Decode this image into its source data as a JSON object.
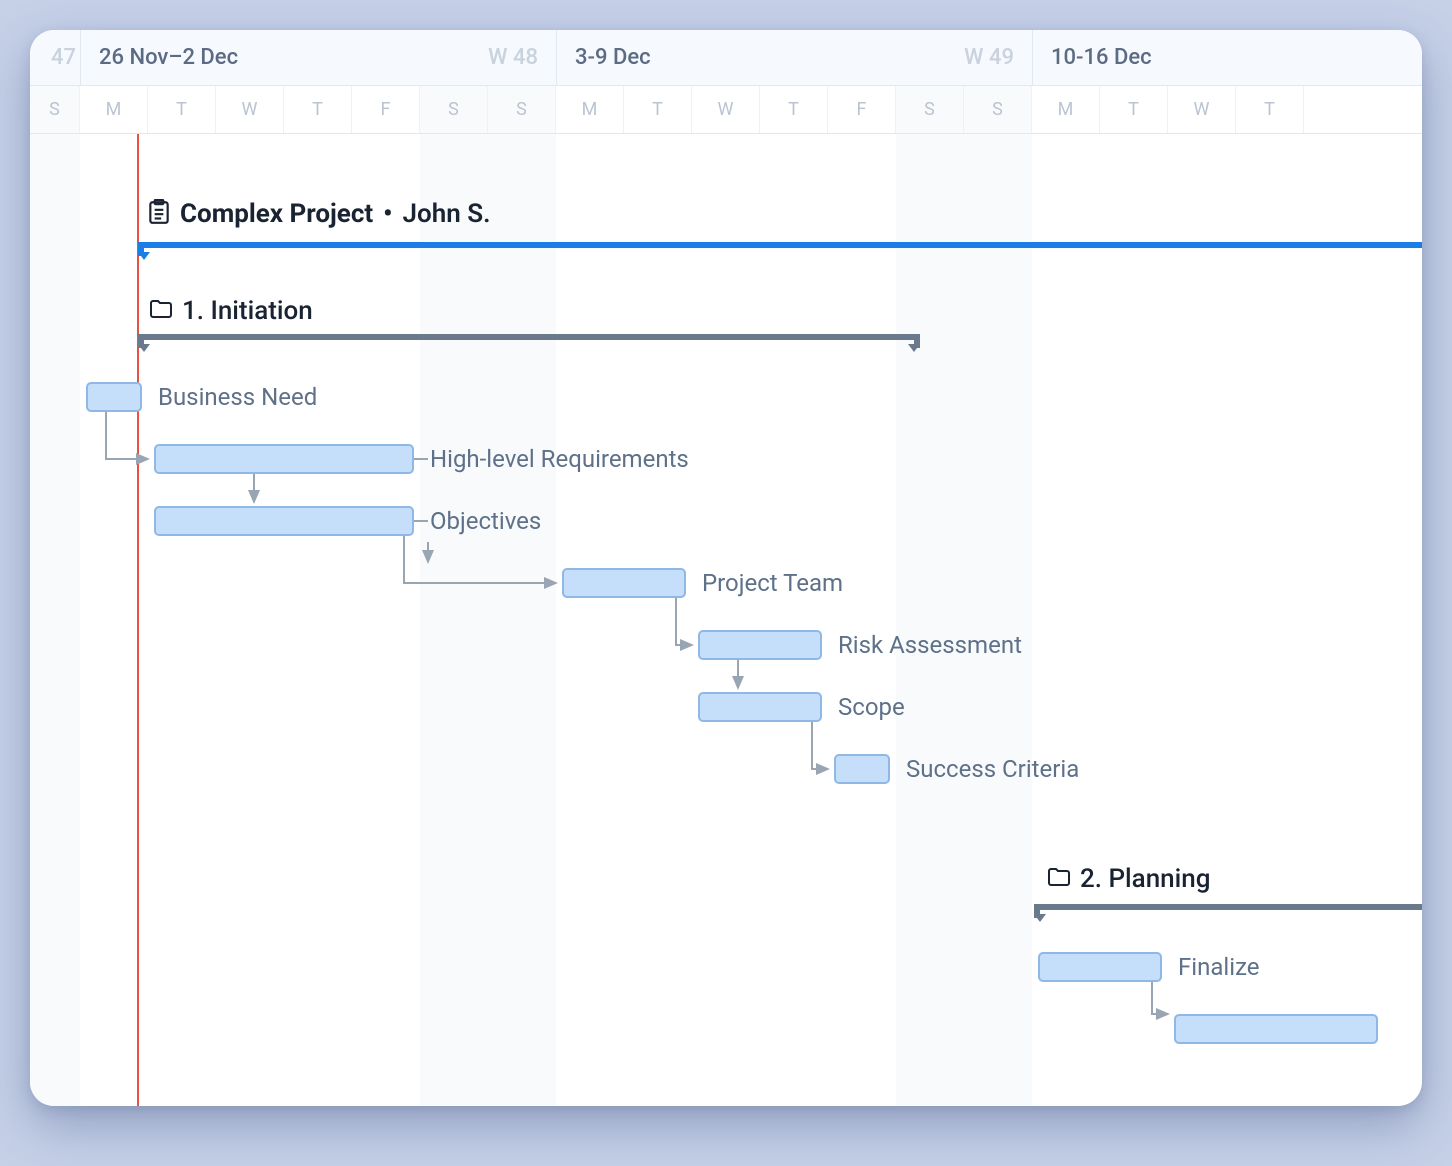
{
  "header": {
    "weeks": [
      {
        "pre": "47"
      },
      {
        "label": "26 Nov–2 Dec",
        "num": "W 48",
        "startCol": 1
      },
      {
        "label": "3-9 Dec",
        "num": "W 49",
        "startCol": 8
      },
      {
        "label": "10-16 Dec",
        "num": "",
        "startCol": 15
      }
    ],
    "days": [
      "S",
      "M",
      "T",
      "W",
      "T",
      "F",
      "S",
      "S",
      "M",
      "T",
      "W",
      "T",
      "F",
      "S",
      "S",
      "M",
      "T",
      "W",
      "T"
    ]
  },
  "project": {
    "title": "Complex Project",
    "owner": "John S."
  },
  "phases": [
    {
      "id": "initiation",
      "label": "1. Initiation",
      "startDay": 1,
      "endDay": 12
    },
    {
      "id": "planning",
      "label": "2. Planning",
      "startDay": 15,
      "endDay": 22
    }
  ],
  "tasks": [
    {
      "id": "biz",
      "label": "Business Need",
      "startDay": 1,
      "days": 1,
      "row": 0
    },
    {
      "id": "req",
      "label": "High-level Requirements",
      "startDay": 2,
      "days": 4,
      "row": 1
    },
    {
      "id": "obj",
      "label": "Objectives",
      "startDay": 2,
      "days": 4,
      "row": 2
    },
    {
      "id": "team",
      "label": "Project Team",
      "startDay": 8,
      "days": 2,
      "row": 3
    },
    {
      "id": "risk",
      "label": "Risk Assessment",
      "startDay": 10,
      "days": 2,
      "row": 4
    },
    {
      "id": "scope",
      "label": "Scope",
      "startDay": 10,
      "days": 2,
      "row": 5
    },
    {
      "id": "succ",
      "label": "Success Criteria",
      "startDay": 12,
      "days": 1,
      "row": 6
    },
    {
      "id": "fin",
      "label": "Finalize",
      "startDay": 15,
      "days": 2,
      "row": 7
    }
  ],
  "layout": {
    "dayPreWidth": 50,
    "dayWidth": 68,
    "taskTop0": 350,
    "taskRowH": 62
  }
}
